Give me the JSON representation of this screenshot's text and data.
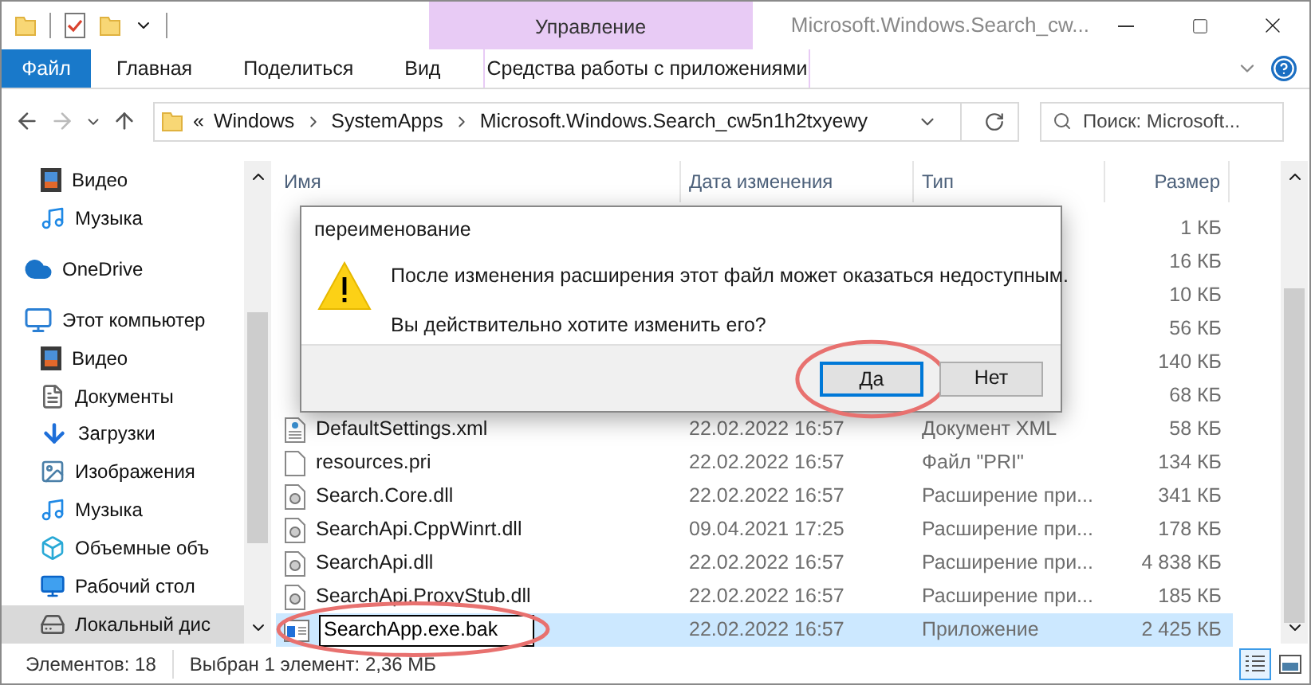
{
  "window": {
    "title": "Microsoft.Windows.Search_cw..."
  },
  "ribbon": {
    "context_group": "Управление",
    "tabs": [
      {
        "label": "Файл",
        "kind": "file",
        "selected": false
      },
      {
        "label": "Главная",
        "kind": "plain",
        "selected": false
      },
      {
        "label": "Поделиться",
        "kind": "plain",
        "selected": false
      },
      {
        "label": "Вид",
        "kind": "plain",
        "selected": false
      },
      {
        "label": "Средства работы с приложениями",
        "kind": "context",
        "selected": false
      }
    ]
  },
  "address": {
    "overflow": "«",
    "path": [
      "Windows",
      "SystemApps",
      "Microsoft.Windows.Search_cw5n1h2txyewy"
    ]
  },
  "search": {
    "placeholder": "Поиск: Microsoft..."
  },
  "sidebar": {
    "items": [
      {
        "label": "Видео",
        "kind": "video",
        "selected": false
      },
      {
        "label": "Музыка",
        "kind": "music",
        "selected": false
      },
      {
        "label": "OneDrive",
        "kind": "cloud",
        "selected": false
      },
      {
        "label": "Этот компьютер",
        "kind": "pc",
        "selected": false,
        "children": [
          {
            "label": "Видео",
            "kind": "video",
            "selected": false
          },
          {
            "label": "Документы",
            "kind": "documents",
            "selected": false
          },
          {
            "label": "Загрузки",
            "kind": "downloads",
            "selected": false
          },
          {
            "label": "Изображения",
            "kind": "pictures",
            "selected": false
          },
          {
            "label": "Музыка",
            "kind": "music",
            "selected": false
          },
          {
            "label": "Объемные объ",
            "kind": "objects",
            "selected": false
          },
          {
            "label": "Рабочий стол",
            "kind": "desktop",
            "selected": false
          },
          {
            "label": "Локальный дис",
            "kind": "drive",
            "selected": true
          }
        ]
      }
    ]
  },
  "table": {
    "columns": [
      "Имя",
      "Дата изменения",
      "Тип",
      "Размер"
    ],
    "rows": [
      {
        "size": "1 КБ",
        "selected": false
      },
      {
        "size": "16 КБ",
        "selected": false
      },
      {
        "size": "10 КБ",
        "selected": false
      },
      {
        "size": "56 КБ",
        "selected": false
      },
      {
        "size": "140 КБ",
        "selected": false
      },
      {
        "size": "68 КБ",
        "selected": false
      },
      {
        "kind": "xml",
        "name": "DefaultSettings.xml",
        "date": "22.02.2022 16:57",
        "type": "Документ XML",
        "size": "58 КБ",
        "selected": false
      },
      {
        "kind": "file",
        "name": "resources.pri",
        "date": "22.02.2022 16:57",
        "type": "Файл \"PRI\"",
        "size": "134 КБ",
        "selected": false
      },
      {
        "kind": "dll",
        "name": "Search.Core.dll",
        "date": "22.02.2022 16:57",
        "type": "Расширение при...",
        "size": "341 КБ",
        "selected": false
      },
      {
        "kind": "dll",
        "name": "SearchApi.CppWinrt.dll",
        "date": "09.04.2021 17:25",
        "type": "Расширение при...",
        "size": "178 КБ",
        "selected": false
      },
      {
        "kind": "dll",
        "name": "SearchApi.dll",
        "date": "22.02.2022 16:57",
        "type": "Расширение при...",
        "size": "4 838 КБ",
        "selected": false
      },
      {
        "kind": "dll",
        "name": "SearchApi.ProxyStub.dll",
        "date": "22.02.2022 16:57",
        "type": "Расширение при...",
        "size": "185 КБ",
        "selected": false
      },
      {
        "kind": "exe",
        "name": "SearchApp.exe.bak",
        "date": "22.02.2022 16:57",
        "type": "Приложение",
        "size": "2 425 КБ",
        "selected": true,
        "editing": true,
        "circled": true
      }
    ]
  },
  "dialog": {
    "title": "переименование",
    "message": "После изменения расширения этот файл может оказаться недоступным.",
    "question": "Вы действительно хотите изменить его?",
    "buttons": [
      {
        "label": "Да",
        "default": true,
        "circled": true
      },
      {
        "label": "Нет",
        "default": false
      }
    ]
  },
  "status_bar": {
    "count": "Элементов: 18",
    "selection": "Выбран 1 элемент: 2,36 МБ"
  },
  "views": [
    {
      "kind": "details",
      "selected": true
    },
    {
      "kind": "tiles",
      "selected": false
    }
  ]
}
